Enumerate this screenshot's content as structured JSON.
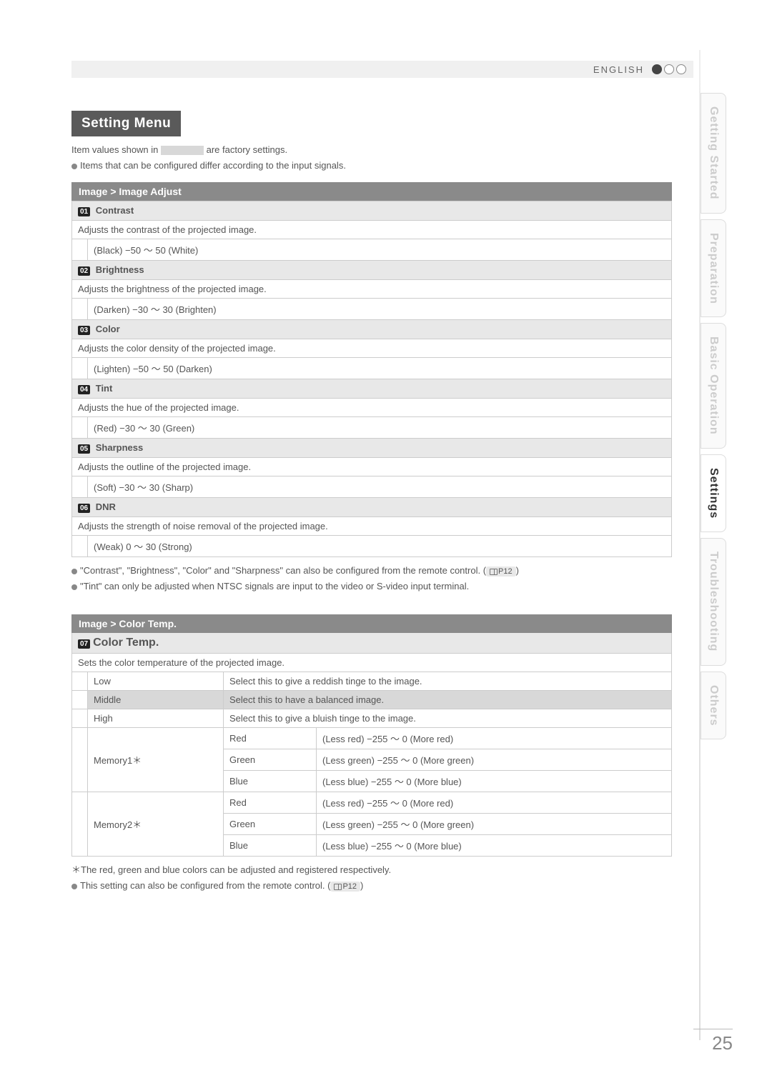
{
  "header": {
    "language": "ENGLISH"
  },
  "side_tabs": [
    {
      "label": "Getting Started",
      "active": false
    },
    {
      "label": "Preparation",
      "active": false
    },
    {
      "label": "Basic Operation",
      "active": false
    },
    {
      "label": "Settings",
      "active": true
    },
    {
      "label": "Troubleshooting",
      "active": false
    },
    {
      "label": "Others",
      "active": false
    }
  ],
  "title": "Setting Menu",
  "intro1a": "Item values shown in ",
  "intro1b": " are factory settings.",
  "intro2": "Items that can be configured differ according to the input signals.",
  "section1": {
    "heading": "Image > Image Adjust",
    "items": [
      {
        "num": "01",
        "name": "Contrast",
        "desc": "Adjusts the contrast of the projected image.",
        "range": "(Black) −50 ～ 50 (White)"
      },
      {
        "num": "02",
        "name": "Brightness",
        "desc": "Adjusts the brightness of the projected image.",
        "range": "(Darken) −30 ～ 30 (Brighten)"
      },
      {
        "num": "03",
        "name": "Color",
        "desc": "Adjusts the color density of the projected image.",
        "range": "(Lighten) −50 ～ 50 (Darken)"
      },
      {
        "num": "04",
        "name": "Tint",
        "desc": "Adjusts the hue of the projected image.",
        "range": "(Red) −30 ～ 30 (Green)"
      },
      {
        "num": "05",
        "name": "Sharpness",
        "desc": "Adjusts the outline of the projected image.",
        "range": "(Soft) −30 ～ 30 (Sharp)"
      },
      {
        "num": "06",
        "name": "DNR",
        "desc": "Adjusts the strength of noise removal of the projected image.",
        "range": "(Weak) 0 ～ 30 (Strong)"
      }
    ],
    "note1": "\"Contrast\", \"Brightness\", \"Color\" and \"Sharpness\" can also be configured from the remote control. (",
    "note1_ref": "P12",
    "note1_end": ")",
    "note2": "\"Tint\" can only be adjusted when NTSC signals are input to the video or S-video input terminal."
  },
  "section2": {
    "heading": "Image > Color Temp.",
    "item_num": "07",
    "item_name": "Color Temp.",
    "desc": "Sets the color temperature of the projected image.",
    "rows": [
      {
        "label": "Low",
        "text": "Select this to give a reddish tinge to the image.",
        "factory": false
      },
      {
        "label": "Middle",
        "text": "Select this to have a balanced image.",
        "factory": true
      },
      {
        "label": "High",
        "text": "Select this to give a bluish tinge to the image.",
        "factory": false
      }
    ],
    "memory": [
      {
        "label": "Memory1＊",
        "rgb": [
          {
            "c": "Red",
            "r": "(Less red) −255 ～ 0 (More red)"
          },
          {
            "c": "Green",
            "r": "(Less green) −255 ～ 0 (More green)"
          },
          {
            "c": "Blue",
            "r": "(Less blue) −255 ～ 0 (More blue)"
          }
        ]
      },
      {
        "label": "Memory2＊",
        "rgb": [
          {
            "c": "Red",
            "r": "(Less red) −255 ～ 0 (More red)"
          },
          {
            "c": "Green",
            "r": "(Less green) −255 ～ 0 (More green)"
          },
          {
            "c": "Blue",
            "r": "(Less blue) −255 ～ 0 (More blue)"
          }
        ]
      }
    ],
    "footnote1": "＊The red, green and blue colors can be adjusted and registered respectively.",
    "footnote2": "This setting can also be configured from the remote control. (",
    "footnote2_ref": "P12",
    "footnote2_end": ")"
  },
  "page_number": "25"
}
